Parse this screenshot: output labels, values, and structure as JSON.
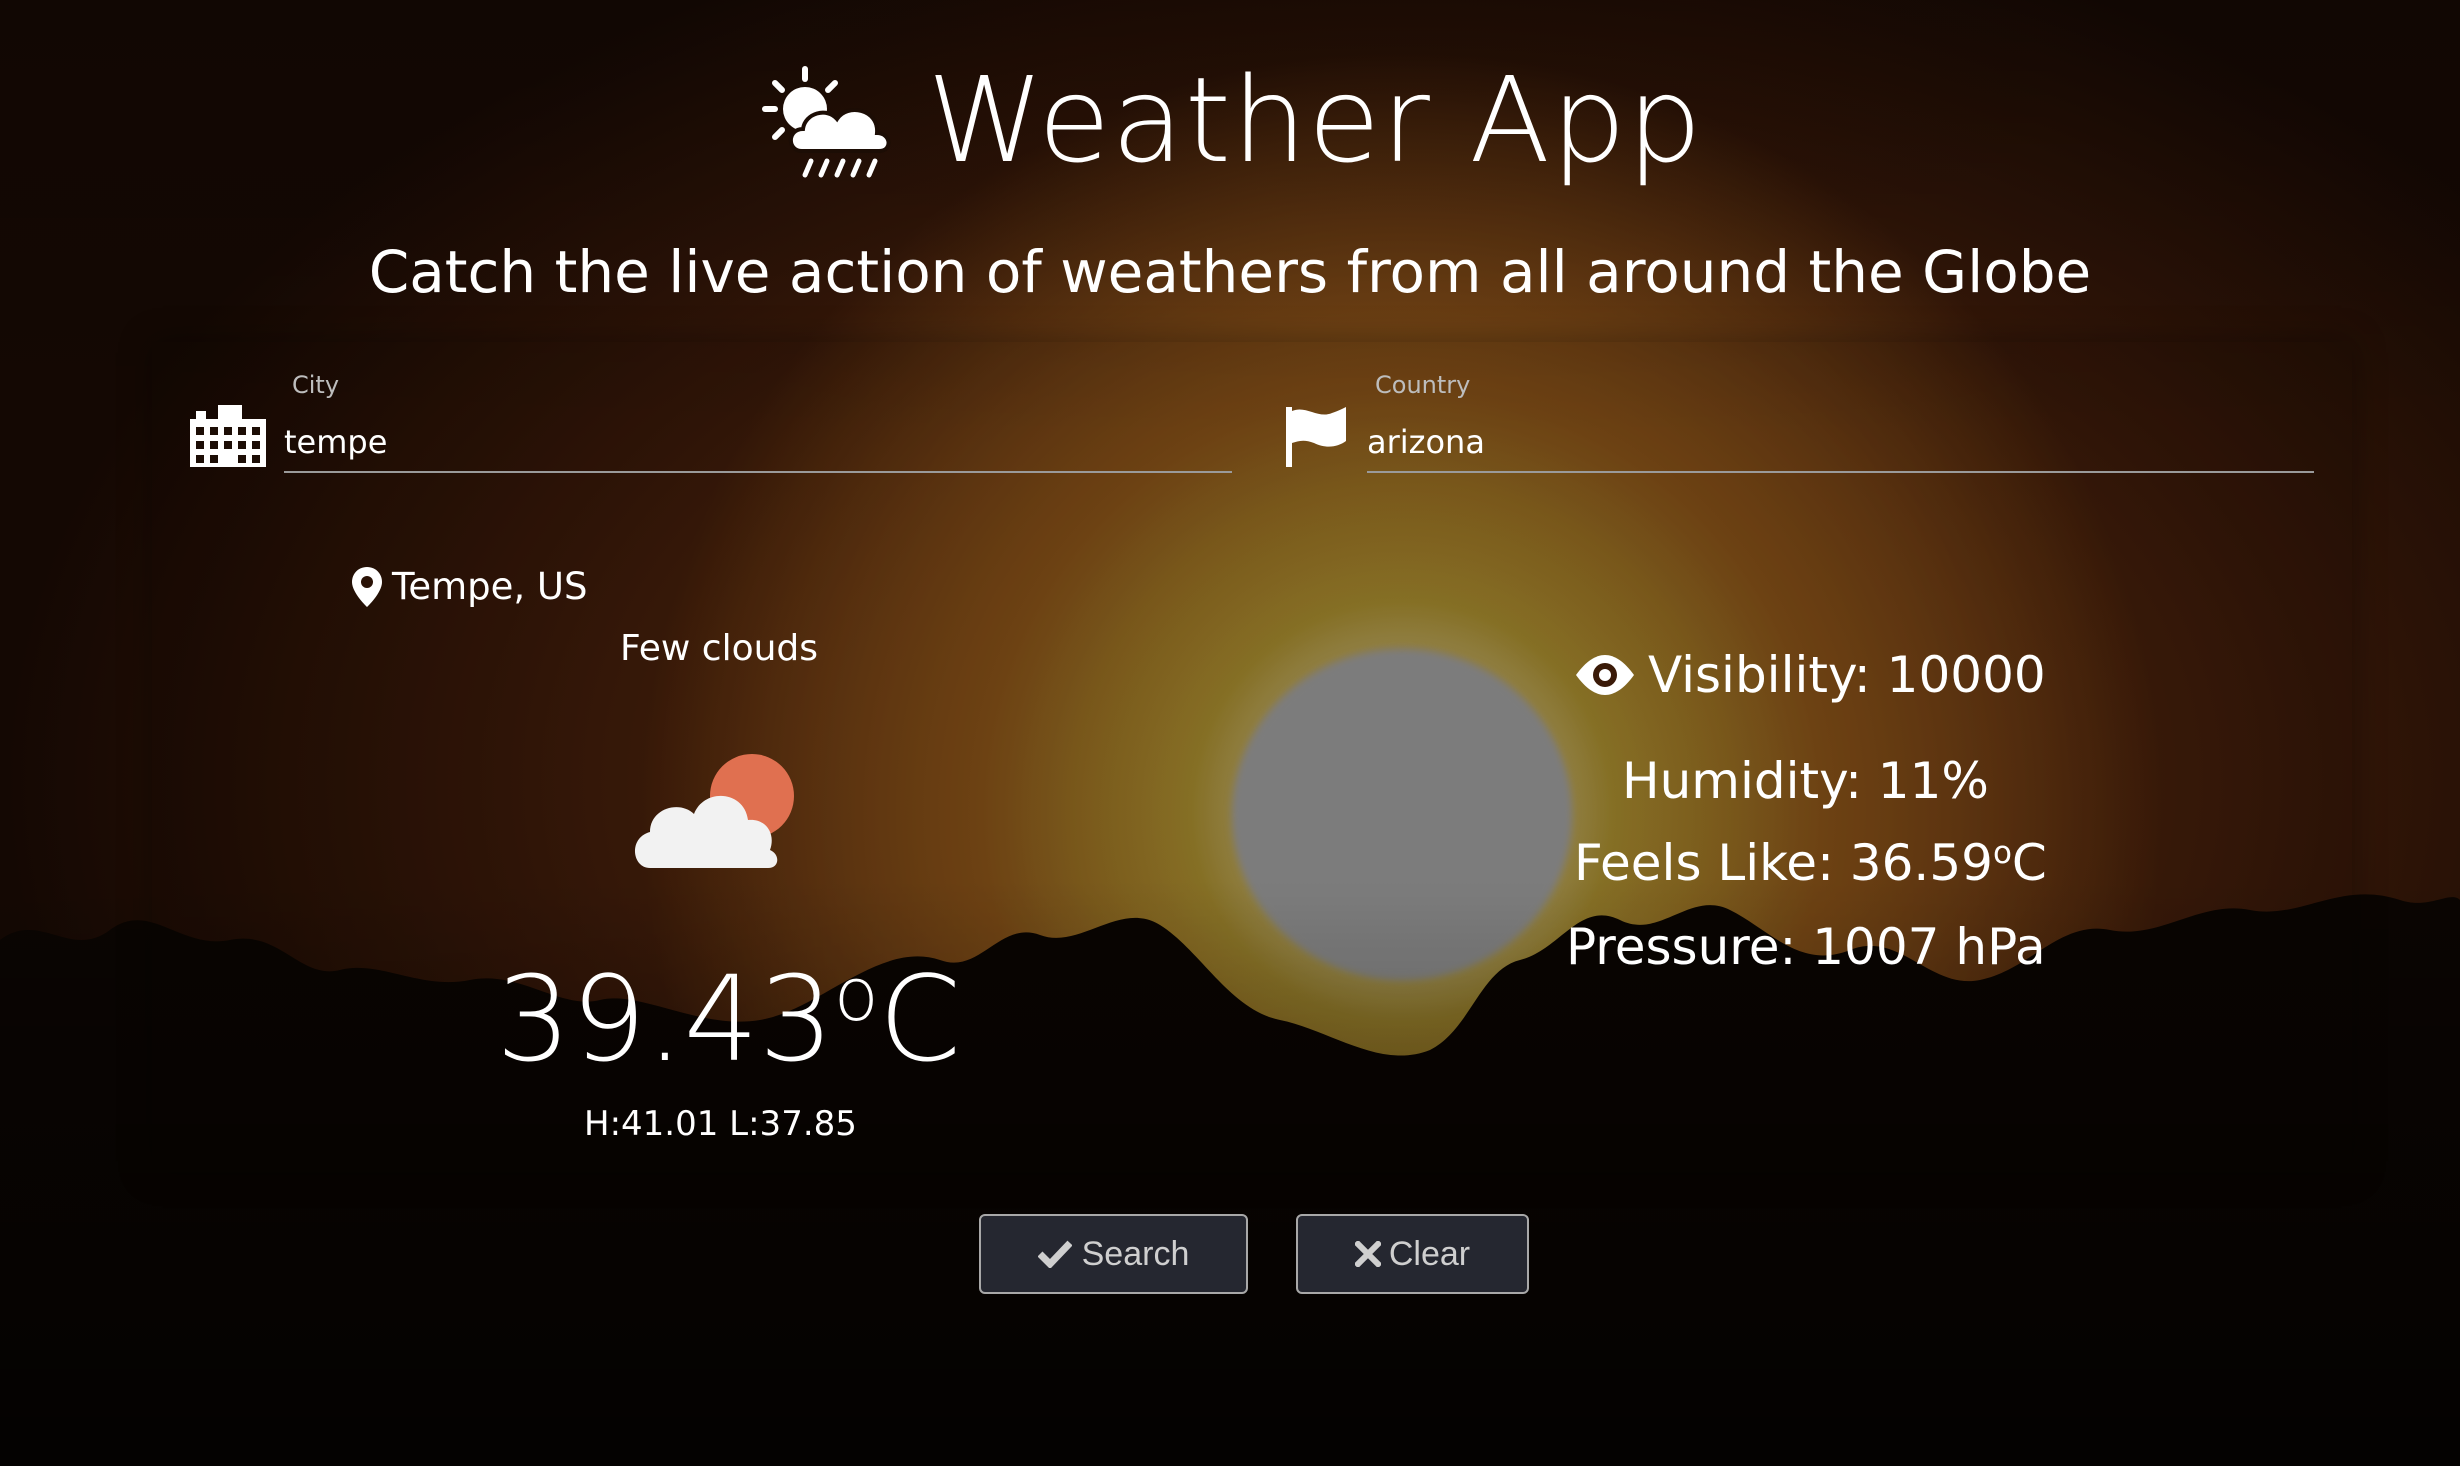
{
  "header": {
    "title": "Weather App",
    "subtitle": "Catch the live action of weathers from all around the Globe",
    "logo_icon": "sun-cloud-rain-icon"
  },
  "form": {
    "city": {
      "label": "City",
      "value": "tempe",
      "icon": "city-buildings-icon"
    },
    "country": {
      "label": "Country",
      "value": "arizona",
      "icon": "flag-icon"
    }
  },
  "weather": {
    "location": "Tempe, US",
    "condition": "Few clouds",
    "condition_icon": "few-clouds-icon",
    "temp_value": "39.43",
    "temp_unit_o": "o",
    "temp_unit_c": "C",
    "hilo": "H:41.01 L:37.85"
  },
  "stats": {
    "visibility": "Visibility: 10000",
    "humidity": "Humidity: 11%",
    "feels_like_prefix": "Feels Like: 36.59",
    "feels_like_o": "o",
    "feels_like_c": "C",
    "pressure": "Pressure: 1007 hPa"
  },
  "buttons": {
    "search": "Search",
    "clear": "Clear"
  },
  "colors": {
    "sun_cloud_accent": "#e07050",
    "cloud": "#f2f2f2",
    "button_bg": "#2a2c34"
  }
}
